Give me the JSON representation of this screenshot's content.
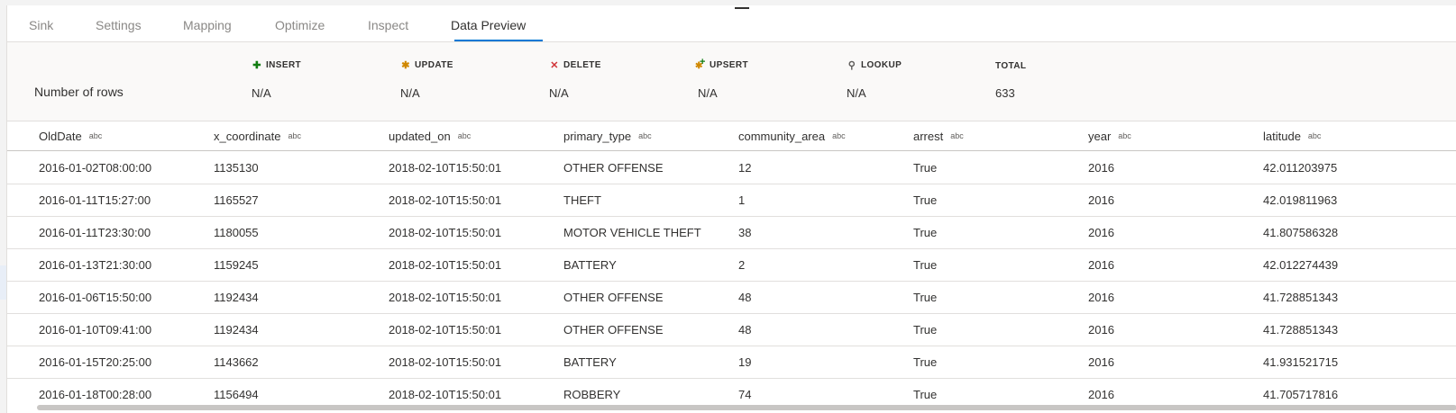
{
  "tabs": [
    {
      "label": "Sink",
      "active": false
    },
    {
      "label": "Settings",
      "active": false
    },
    {
      "label": "Mapping",
      "active": false
    },
    {
      "label": "Optimize",
      "active": false
    },
    {
      "label": "Inspect",
      "active": false
    },
    {
      "label": "Data Preview",
      "active": true
    }
  ],
  "stats": {
    "row_label": "Number of rows",
    "items": [
      {
        "name": "INSERT",
        "icon": "plus-icon",
        "value": "N/A"
      },
      {
        "name": "UPDATE",
        "icon": "asterisk-icon",
        "value": "N/A"
      },
      {
        "name": "DELETE",
        "icon": "x-icon",
        "value": "N/A"
      },
      {
        "name": "UPSERT",
        "icon": "upsert-icon",
        "value": "N/A"
      },
      {
        "name": "LOOKUP",
        "icon": "search-icon",
        "value": "N/A"
      },
      {
        "name": "TOTAL",
        "icon": "",
        "value": "633"
      }
    ]
  },
  "columns": [
    {
      "name": "OldDate",
      "type": "abc"
    },
    {
      "name": "x_coordinate",
      "type": "abc"
    },
    {
      "name": "updated_on",
      "type": "abc"
    },
    {
      "name": "primary_type",
      "type": "abc"
    },
    {
      "name": "community_area",
      "type": "abc"
    },
    {
      "name": "arrest",
      "type": "abc"
    },
    {
      "name": "year",
      "type": "abc"
    },
    {
      "name": "latitude",
      "type": "abc"
    }
  ],
  "rows": [
    [
      "2016-01-02T08:00:00",
      "1135130",
      "2018-02-10T15:50:01",
      "OTHER OFFENSE",
      "12",
      "True",
      "2016",
      "42.011203975"
    ],
    [
      "2016-01-11T15:27:00",
      "1165527",
      "2018-02-10T15:50:01",
      "THEFT",
      "1",
      "True",
      "2016",
      "42.019811963"
    ],
    [
      "2016-01-11T23:30:00",
      "1180055",
      "2018-02-10T15:50:01",
      "MOTOR VEHICLE THEFT",
      "38",
      "True",
      "2016",
      "41.807586328"
    ],
    [
      "2016-01-13T21:30:00",
      "1159245",
      "2018-02-10T15:50:01",
      "BATTERY",
      "2",
      "True",
      "2016",
      "42.012274439"
    ],
    [
      "2016-01-06T15:50:00",
      "1192434",
      "2018-02-10T15:50:01",
      "OTHER OFFENSE",
      "48",
      "True",
      "2016",
      "41.728851343"
    ],
    [
      "2016-01-10T09:41:00",
      "1192434",
      "2018-02-10T15:50:01",
      "OTHER OFFENSE",
      "48",
      "True",
      "2016",
      "41.728851343"
    ],
    [
      "2016-01-15T20:25:00",
      "1143662",
      "2018-02-10T15:50:01",
      "BATTERY",
      "19",
      "True",
      "2016",
      "41.931521715"
    ],
    [
      "2016-01-18T00:28:00",
      "1156494",
      "2018-02-10T15:50:01",
      "ROBBERY",
      "74",
      "True",
      "2016",
      "41.705717816"
    ]
  ]
}
